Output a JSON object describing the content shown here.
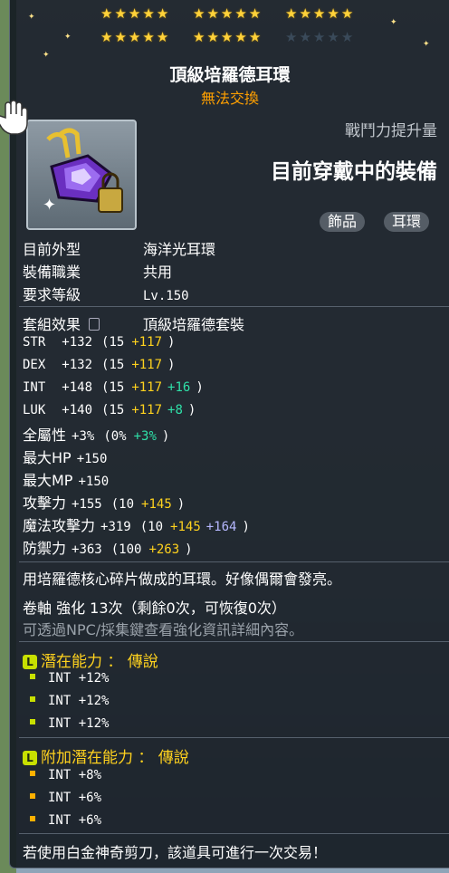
{
  "stars": {
    "row1_lit": [
      5,
      5,
      5
    ],
    "row2_lit": [
      5,
      5,
      0
    ]
  },
  "item": {
    "name": "頂級培羅德耳環",
    "trade_status": "無法交換",
    "compare_label": "戰鬥力提升量",
    "equipped_label": "目前穿戴中的裝備",
    "tags": [
      "飾品",
      "耳環"
    ]
  },
  "info": [
    {
      "label": "目前外型",
      "value": "海洋光耳環"
    },
    {
      "label": "裝備職業",
      "value": "共用"
    },
    {
      "label": "要求等級",
      "value": "Lv.150"
    }
  ],
  "set": {
    "label": "套組效果",
    "value": "頂級培羅德套裝"
  },
  "stats": [
    {
      "key": "STR",
      "total": "+132",
      "base": "(15",
      "bonus": "+117",
      "extra": "",
      "close": ")"
    },
    {
      "key": "DEX",
      "total": "+132",
      "base": "(15",
      "bonus": "+117",
      "extra": "",
      "close": ")"
    },
    {
      "key": "INT",
      "total": "+148",
      "base": "(15",
      "bonus": "+117",
      "extra": "+16",
      "close": ")"
    },
    {
      "key": "LUK",
      "total": "+140",
      "base": "(15",
      "bonus": "+117",
      "extra": "+8",
      "close": ")"
    },
    {
      "key": "全屬性",
      "total": "+3%",
      "base": "(0%",
      "bonus": "",
      "extra": "+3%",
      "close": ")"
    },
    {
      "key": "最大HP",
      "total": "+150",
      "base": "",
      "bonus": "",
      "extra": "",
      "close": ""
    },
    {
      "key": "最大MP",
      "total": "+150",
      "base": "",
      "bonus": "",
      "extra": "",
      "close": ""
    },
    {
      "key": "攻擊力",
      "total": "+155",
      "base": "(10",
      "bonus": "+145",
      "extra": "",
      "close": ")"
    },
    {
      "key": "魔法攻擊力",
      "total": "+319",
      "base": "(10",
      "bonus": "+145",
      "extra": "+164",
      "close": ")"
    },
    {
      "key": "防禦力",
      "total": "+363",
      "base": "(100",
      "bonus": "+263",
      "extra": "",
      "close": ")"
    }
  ],
  "description": "用培羅德核心碎片做成的耳環。好像偶爾會發亮。",
  "scroll": "卷軸 強化 13次（剩餘0次，可恢復0次）",
  "scroll_hint": "可透過NPC/採集鍵查看強化資訊詳細內容。",
  "potential": {
    "badge": "L",
    "title": "潛在能力 ： 傳說",
    "lines": [
      "INT +12%",
      "INT +12%",
      "INT +12%"
    ]
  },
  "additional": {
    "badge": "L",
    "title": "附加潛在能力 ： 傳說",
    "lines": [
      "INT +8%",
      "INT +6%",
      "INT +6%"
    ]
  },
  "footer": "若使用白金神奇剪刀，該道具可進行一次交易！",
  "colors": {
    "gold": "#ffd21e",
    "orange": "#ffa000",
    "green": "#2fe0a8",
    "lavender": "#b6b8ff",
    "potential_dot": "#c8e000",
    "additional_dot": "#ffb000"
  }
}
